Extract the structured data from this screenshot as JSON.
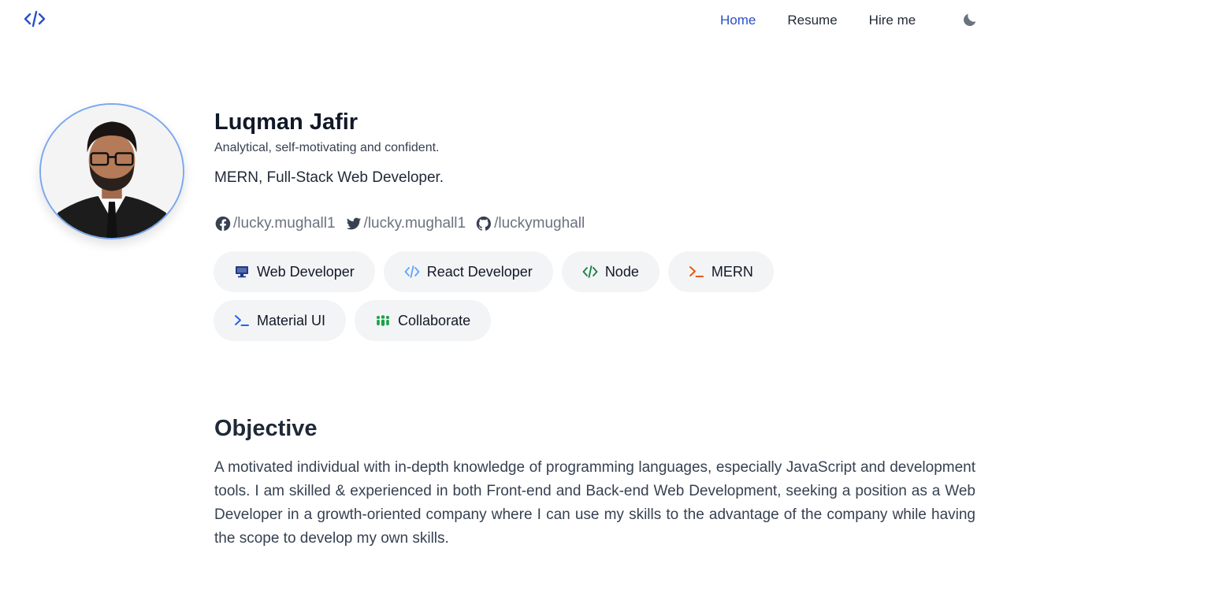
{
  "header": {
    "logo_icon": "code-icon",
    "nav": [
      {
        "label": "Home",
        "active": true
      },
      {
        "label": "Resume",
        "active": false
      },
      {
        "label": "Hire me",
        "active": false
      }
    ],
    "theme_toggle_icon": "moon-icon"
  },
  "profile": {
    "name": "Luqman Jafir",
    "tagline": "Analytical, self-motivating and confident.",
    "role": "MERN, Full-Stack Web Developer.",
    "socials": [
      {
        "icon": "facebook-icon",
        "handle": "/lucky.mughall1"
      },
      {
        "icon": "twitter-icon",
        "handle": "/lucky.mughall1"
      },
      {
        "icon": "github-icon",
        "handle": "/luckymughall"
      }
    ]
  },
  "skills": [
    {
      "label": "Web Developer",
      "icon": "monitor-icon",
      "color": "#1e3a8a"
    },
    {
      "label": "React Developer",
      "icon": "code-icon",
      "color": "#60a5fa"
    },
    {
      "label": "Node",
      "icon": "code-icon",
      "color": "#15803d"
    },
    {
      "label": "MERN",
      "icon": "terminal-icon",
      "color": "#ea580c"
    },
    {
      "label": "Material UI",
      "icon": "terminal-icon",
      "color": "#2563eb"
    },
    {
      "label": "Collaborate",
      "icon": "users-icon",
      "color": "#16a34a"
    }
  ],
  "objective": {
    "title": "Objective",
    "text": "A motivated individual with in-depth knowledge of programming languages, especially JavaScript and development tools. I am skilled & experienced in both Front-end and Back-end Web Development, seeking a position as a Web Developer in a growth-oriented company where I can use my skills to the advantage of the company while having the scope to develop my own skills."
  },
  "colors": {
    "accent": "#2b4fc7",
    "avatar_border": "#7aa7ef",
    "chip_bg": "#f3f4f6"
  }
}
